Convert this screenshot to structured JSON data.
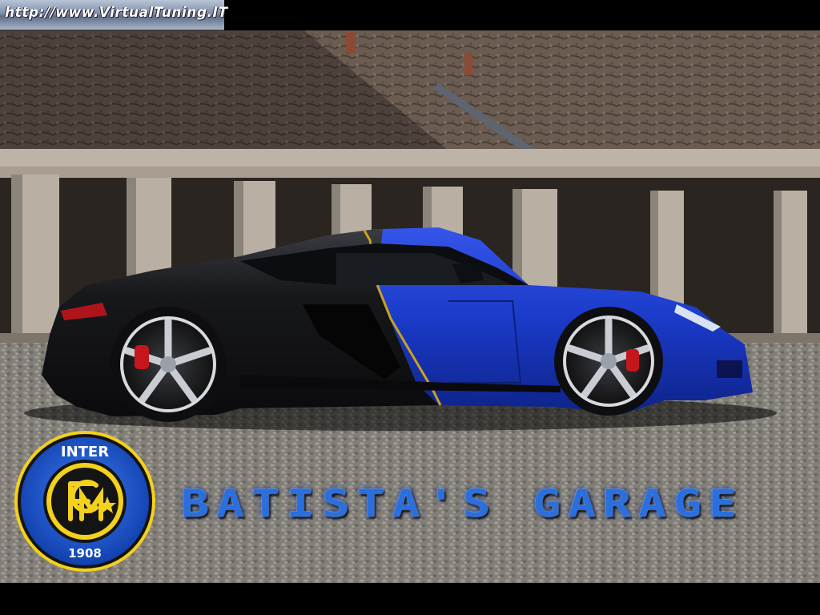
{
  "watermark": {
    "url_text": "http://www.VirtualTuning.IT"
  },
  "logo": {
    "top_text": "INTER",
    "bottom_text": "1908",
    "colors": {
      "ring": "#1a1a1a",
      "blue": "#1e5bd6",
      "gold": "#f3d11c",
      "black": "#111111"
    }
  },
  "title": {
    "text": "BATISTA'S GARAGE",
    "color": "#2a6fe0"
  },
  "car": {
    "body_black": "#121316",
    "body_blue": "#1a3ac8",
    "stripe": "#c9a21d",
    "caliper": "#c4161c"
  }
}
